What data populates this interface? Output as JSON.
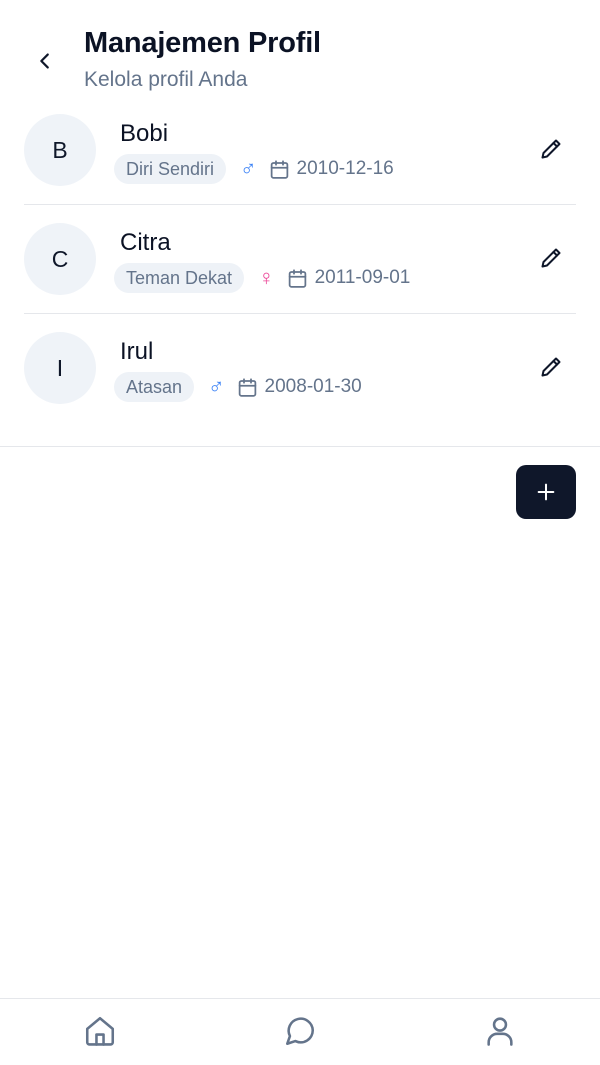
{
  "header": {
    "title": "Manajemen Profil",
    "subtitle": "Kelola profil Anda",
    "back_icon": "chevron-left-icon"
  },
  "profiles": [
    {
      "initial": "B",
      "name": "Bobi",
      "relation": "Diri Sendiri",
      "gender": "male",
      "gender_symbol": "♂",
      "dob": "2010-12-16"
    },
    {
      "initial": "C",
      "name": "Citra",
      "relation": "Teman Dekat",
      "gender": "female",
      "gender_symbol": "♀",
      "dob": "2011-09-01"
    },
    {
      "initial": "I",
      "name": "Irul",
      "relation": "Atasan",
      "gender": "male",
      "gender_symbol": "♂",
      "dob": "2008-01-30"
    }
  ],
  "fab": {
    "icon": "plus-icon"
  },
  "bottom_nav": [
    {
      "icon": "home-icon"
    },
    {
      "icon": "chat-icon"
    },
    {
      "icon": "user-icon"
    }
  ],
  "colors": {
    "primary": "#0f172a",
    "male": "#3b82f6",
    "female": "#ec4899",
    "muted": "#64748b"
  }
}
